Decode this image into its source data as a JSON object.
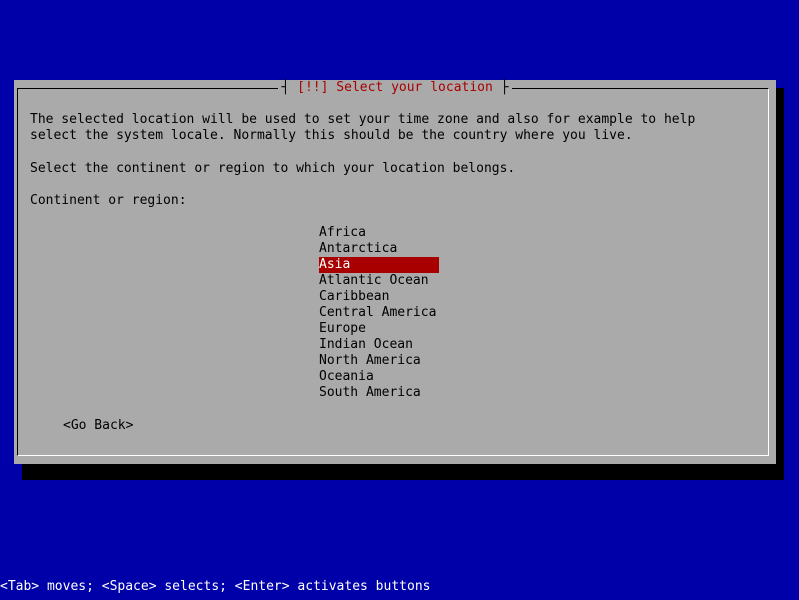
{
  "dialog": {
    "title": "[!!] Select your location",
    "description_line1": "The selected location will be used to set your time zone and also for example to help",
    "description_line2": "select the system locale. Normally this should be the country where you live.",
    "prompt": "Select the continent or region to which your location belongs.",
    "field_label": "Continent or region:",
    "options": [
      "Africa",
      "Antarctica",
      "Asia",
      "Atlantic Ocean",
      "Caribbean",
      "Central America",
      "Europe",
      "Indian Ocean",
      "North America",
      "Oceania",
      "South America"
    ],
    "selected_option": "Asia",
    "go_back_label": "<Go Back>"
  },
  "statusbar": {
    "text": "<Tab> moves; <Space> selects; <Enter> activates buttons"
  },
  "colors": {
    "background": "#0000a8",
    "dialog": "#aaaaaa",
    "title": "#a80000",
    "selection": "#a80000",
    "status_text": "#ffffff"
  }
}
